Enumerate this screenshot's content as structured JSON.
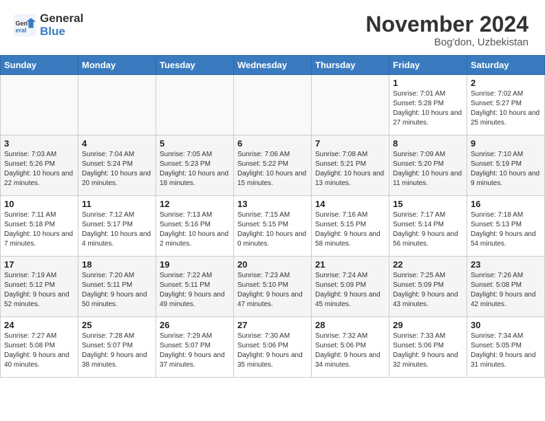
{
  "header": {
    "logo_general": "General",
    "logo_blue": "Blue",
    "month_title": "November 2024",
    "location": "Bog'don, Uzbekistan"
  },
  "weekdays": [
    "Sunday",
    "Monday",
    "Tuesday",
    "Wednesday",
    "Thursday",
    "Friday",
    "Saturday"
  ],
  "weeks": [
    [
      {
        "day": "",
        "info": ""
      },
      {
        "day": "",
        "info": ""
      },
      {
        "day": "",
        "info": ""
      },
      {
        "day": "",
        "info": ""
      },
      {
        "day": "",
        "info": ""
      },
      {
        "day": "1",
        "info": "Sunrise: 7:01 AM\nSunset: 5:28 PM\nDaylight: 10 hours and 27 minutes."
      },
      {
        "day": "2",
        "info": "Sunrise: 7:02 AM\nSunset: 5:27 PM\nDaylight: 10 hours and 25 minutes."
      }
    ],
    [
      {
        "day": "3",
        "info": "Sunrise: 7:03 AM\nSunset: 5:26 PM\nDaylight: 10 hours and 22 minutes."
      },
      {
        "day": "4",
        "info": "Sunrise: 7:04 AM\nSunset: 5:24 PM\nDaylight: 10 hours and 20 minutes."
      },
      {
        "day": "5",
        "info": "Sunrise: 7:05 AM\nSunset: 5:23 PM\nDaylight: 10 hours and 18 minutes."
      },
      {
        "day": "6",
        "info": "Sunrise: 7:06 AM\nSunset: 5:22 PM\nDaylight: 10 hours and 15 minutes."
      },
      {
        "day": "7",
        "info": "Sunrise: 7:08 AM\nSunset: 5:21 PM\nDaylight: 10 hours and 13 minutes."
      },
      {
        "day": "8",
        "info": "Sunrise: 7:09 AM\nSunset: 5:20 PM\nDaylight: 10 hours and 11 minutes."
      },
      {
        "day": "9",
        "info": "Sunrise: 7:10 AM\nSunset: 5:19 PM\nDaylight: 10 hours and 9 minutes."
      }
    ],
    [
      {
        "day": "10",
        "info": "Sunrise: 7:11 AM\nSunset: 5:18 PM\nDaylight: 10 hours and 7 minutes."
      },
      {
        "day": "11",
        "info": "Sunrise: 7:12 AM\nSunset: 5:17 PM\nDaylight: 10 hours and 4 minutes."
      },
      {
        "day": "12",
        "info": "Sunrise: 7:13 AM\nSunset: 5:16 PM\nDaylight: 10 hours and 2 minutes."
      },
      {
        "day": "13",
        "info": "Sunrise: 7:15 AM\nSunset: 5:15 PM\nDaylight: 10 hours and 0 minutes."
      },
      {
        "day": "14",
        "info": "Sunrise: 7:16 AM\nSunset: 5:15 PM\nDaylight: 9 hours and 58 minutes."
      },
      {
        "day": "15",
        "info": "Sunrise: 7:17 AM\nSunset: 5:14 PM\nDaylight: 9 hours and 56 minutes."
      },
      {
        "day": "16",
        "info": "Sunrise: 7:18 AM\nSunset: 5:13 PM\nDaylight: 9 hours and 54 minutes."
      }
    ],
    [
      {
        "day": "17",
        "info": "Sunrise: 7:19 AM\nSunset: 5:12 PM\nDaylight: 9 hours and 52 minutes."
      },
      {
        "day": "18",
        "info": "Sunrise: 7:20 AM\nSunset: 5:11 PM\nDaylight: 9 hours and 50 minutes."
      },
      {
        "day": "19",
        "info": "Sunrise: 7:22 AM\nSunset: 5:11 PM\nDaylight: 9 hours and 49 minutes."
      },
      {
        "day": "20",
        "info": "Sunrise: 7:23 AM\nSunset: 5:10 PM\nDaylight: 9 hours and 47 minutes."
      },
      {
        "day": "21",
        "info": "Sunrise: 7:24 AM\nSunset: 5:09 PM\nDaylight: 9 hours and 45 minutes."
      },
      {
        "day": "22",
        "info": "Sunrise: 7:25 AM\nSunset: 5:09 PM\nDaylight: 9 hours and 43 minutes."
      },
      {
        "day": "23",
        "info": "Sunrise: 7:26 AM\nSunset: 5:08 PM\nDaylight: 9 hours and 42 minutes."
      }
    ],
    [
      {
        "day": "24",
        "info": "Sunrise: 7:27 AM\nSunset: 5:08 PM\nDaylight: 9 hours and 40 minutes."
      },
      {
        "day": "25",
        "info": "Sunrise: 7:28 AM\nSunset: 5:07 PM\nDaylight: 9 hours and 38 minutes."
      },
      {
        "day": "26",
        "info": "Sunrise: 7:29 AM\nSunset: 5:07 PM\nDaylight: 9 hours and 37 minutes."
      },
      {
        "day": "27",
        "info": "Sunrise: 7:30 AM\nSunset: 5:06 PM\nDaylight: 9 hours and 35 minutes."
      },
      {
        "day": "28",
        "info": "Sunrise: 7:32 AM\nSunset: 5:06 PM\nDaylight: 9 hours and 34 minutes."
      },
      {
        "day": "29",
        "info": "Sunrise: 7:33 AM\nSunset: 5:06 PM\nDaylight: 9 hours and 32 minutes."
      },
      {
        "day": "30",
        "info": "Sunrise: 7:34 AM\nSunset: 5:05 PM\nDaylight: 9 hours and 31 minutes."
      }
    ]
  ]
}
